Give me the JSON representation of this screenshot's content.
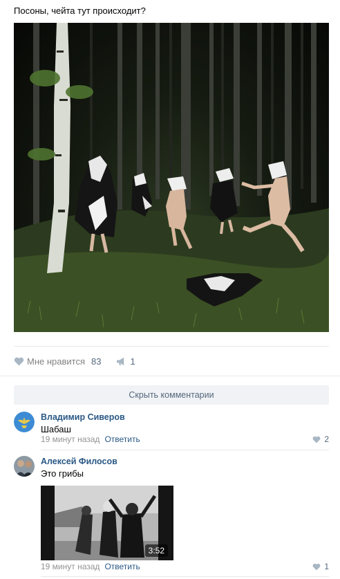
{
  "post": {
    "text": "Посоны, чейта тут происходит?",
    "photo_icon": "forest-night-photo"
  },
  "actions": {
    "like_label": "Мне нравится",
    "like_count": "83",
    "share_count": "1",
    "like_icon": "heart-icon",
    "share_icon": "megaphone-icon"
  },
  "comments_toggle": "Скрыть комментарии",
  "comments": [
    {
      "author": "Владимир Сиверов",
      "text": "Шабаш",
      "time": "19 минут назад",
      "reply": "Ответить",
      "likes": "2"
    },
    {
      "author": "Алексей Филосов",
      "text": "Это грибы",
      "time": "19 минут назад",
      "reply": "Ответить",
      "likes": "1",
      "video_duration": "3:52"
    }
  ],
  "colors": {
    "link": "#2a5885",
    "secondary": "#828282",
    "button_bg": "#f0f2f5",
    "divider": "#e7e8ec"
  }
}
